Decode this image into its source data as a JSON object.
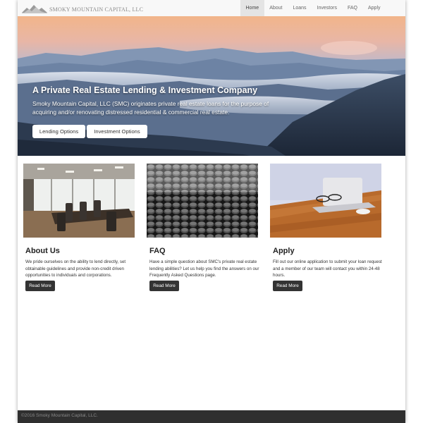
{
  "brand": {
    "name": "SMOKY MOUNTAIN CAPITAL, LLC"
  },
  "nav": {
    "items": [
      "Home",
      "About",
      "Loans",
      "Investors",
      "FAQ",
      "Apply"
    ],
    "active": "Home"
  },
  "hero": {
    "title": "A Private Real Estate Lending & Investment Company",
    "description": "Smoky Mountain Capital, LLC (SMC) originates private real estate loans for the purpose of acquiring and/or renovating distressed residential & commercial real estate.",
    "buttons": [
      "Lending Options",
      "Investment Options"
    ]
  },
  "columns": [
    {
      "title": "About Us",
      "text": "We pride ourselves on the ability to lend directly, set obtainable guidelines and provide non-credit driven opportunities to individuals and corporations.",
      "button": "Read More"
    },
    {
      "title": "FAQ",
      "text": "Have a simple question about SMC's private real estate lending abilities? Let us help you find the answers on our Frequently Asked Questions page.",
      "button": "Read More"
    },
    {
      "title": "Apply",
      "text": "Fill out our online application to submit your loan request and a member of our team will contact you within 24-48 hours.",
      "button": "Read More"
    }
  ],
  "footer": {
    "text": "©2016 Smoky Mountain Capital, LLC."
  },
  "colors": {
    "navbar_bg": "#f8f8f8",
    "nav_active_bg": "#e4e4e4",
    "button_dark": "#333333",
    "footer_bg": "#2f2f2f"
  },
  "icons": {
    "logo": "mountain-logo-icon"
  }
}
